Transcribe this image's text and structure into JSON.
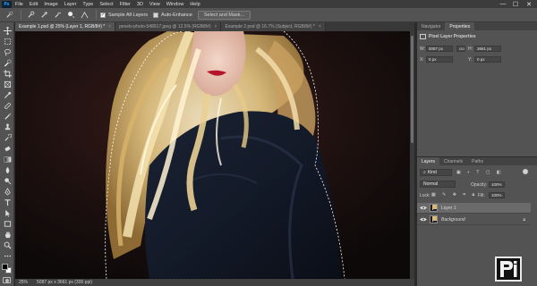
{
  "app": {
    "logo_text": "Ps"
  },
  "menu": [
    "File",
    "Edit",
    "Image",
    "Layer",
    "Type",
    "Select",
    "Filter",
    "3D",
    "View",
    "Window",
    "Help"
  ],
  "window_controls": {
    "minimize": "—",
    "maximize": "☐",
    "close": "✕"
  },
  "options_bar": {
    "sample_all_layers_label": "Sample All Layers",
    "sample_all_layers_checked": true,
    "auto_enhance_label": "Auto-Enhance",
    "auto_enhance_checked": false,
    "select_mask_button": "Select and Mask..."
  },
  "tabs": [
    {
      "label": "Example 1.psd @ 25% (Layer 1, RGB/8#) *",
      "active": true
    },
    {
      "label": "pexels-photo-548917.jpeg @ 12.5% (RGB/8#)",
      "active": false
    },
    {
      "label": "Example 2.psd @ 16.7% (Subject, RGB/8#) *",
      "active": false
    }
  ],
  "tab_close": "×",
  "status": {
    "zoom": "25%",
    "doc_info": "5087 px x 3661 px (300 ppi)"
  },
  "properties_panel": {
    "tabs": [
      "Navigator",
      "Properties"
    ],
    "active_tab": "Properties",
    "title": "Pixel Layer Properties",
    "w_label": "W:",
    "w_value": "5087 px",
    "h_label": "H:",
    "h_value": "3661 px",
    "x_label": "X:",
    "x_value": "0 px",
    "y_label": "Y:",
    "y_value": "0 px",
    "link_label": "GO"
  },
  "layers_panel": {
    "tabs": [
      "Layers",
      "Channels",
      "Paths"
    ],
    "active_tab": "Layers",
    "kind_filter": "Kind",
    "blend_mode": "Normal",
    "opacity_label": "Opacity:",
    "opacity_value": "100%",
    "lock_label": "Lock:",
    "fill_label": "Fill:",
    "fill_value": "100%",
    "layers": [
      {
        "name": "Layer 1",
        "selected": true,
        "visible": true
      },
      {
        "name": "Background",
        "selected": false,
        "visible": true
      }
    ]
  },
  "colors": {
    "accent_blue": "#31a8ff",
    "foreground": "#000000",
    "background": "#ffffff"
  }
}
